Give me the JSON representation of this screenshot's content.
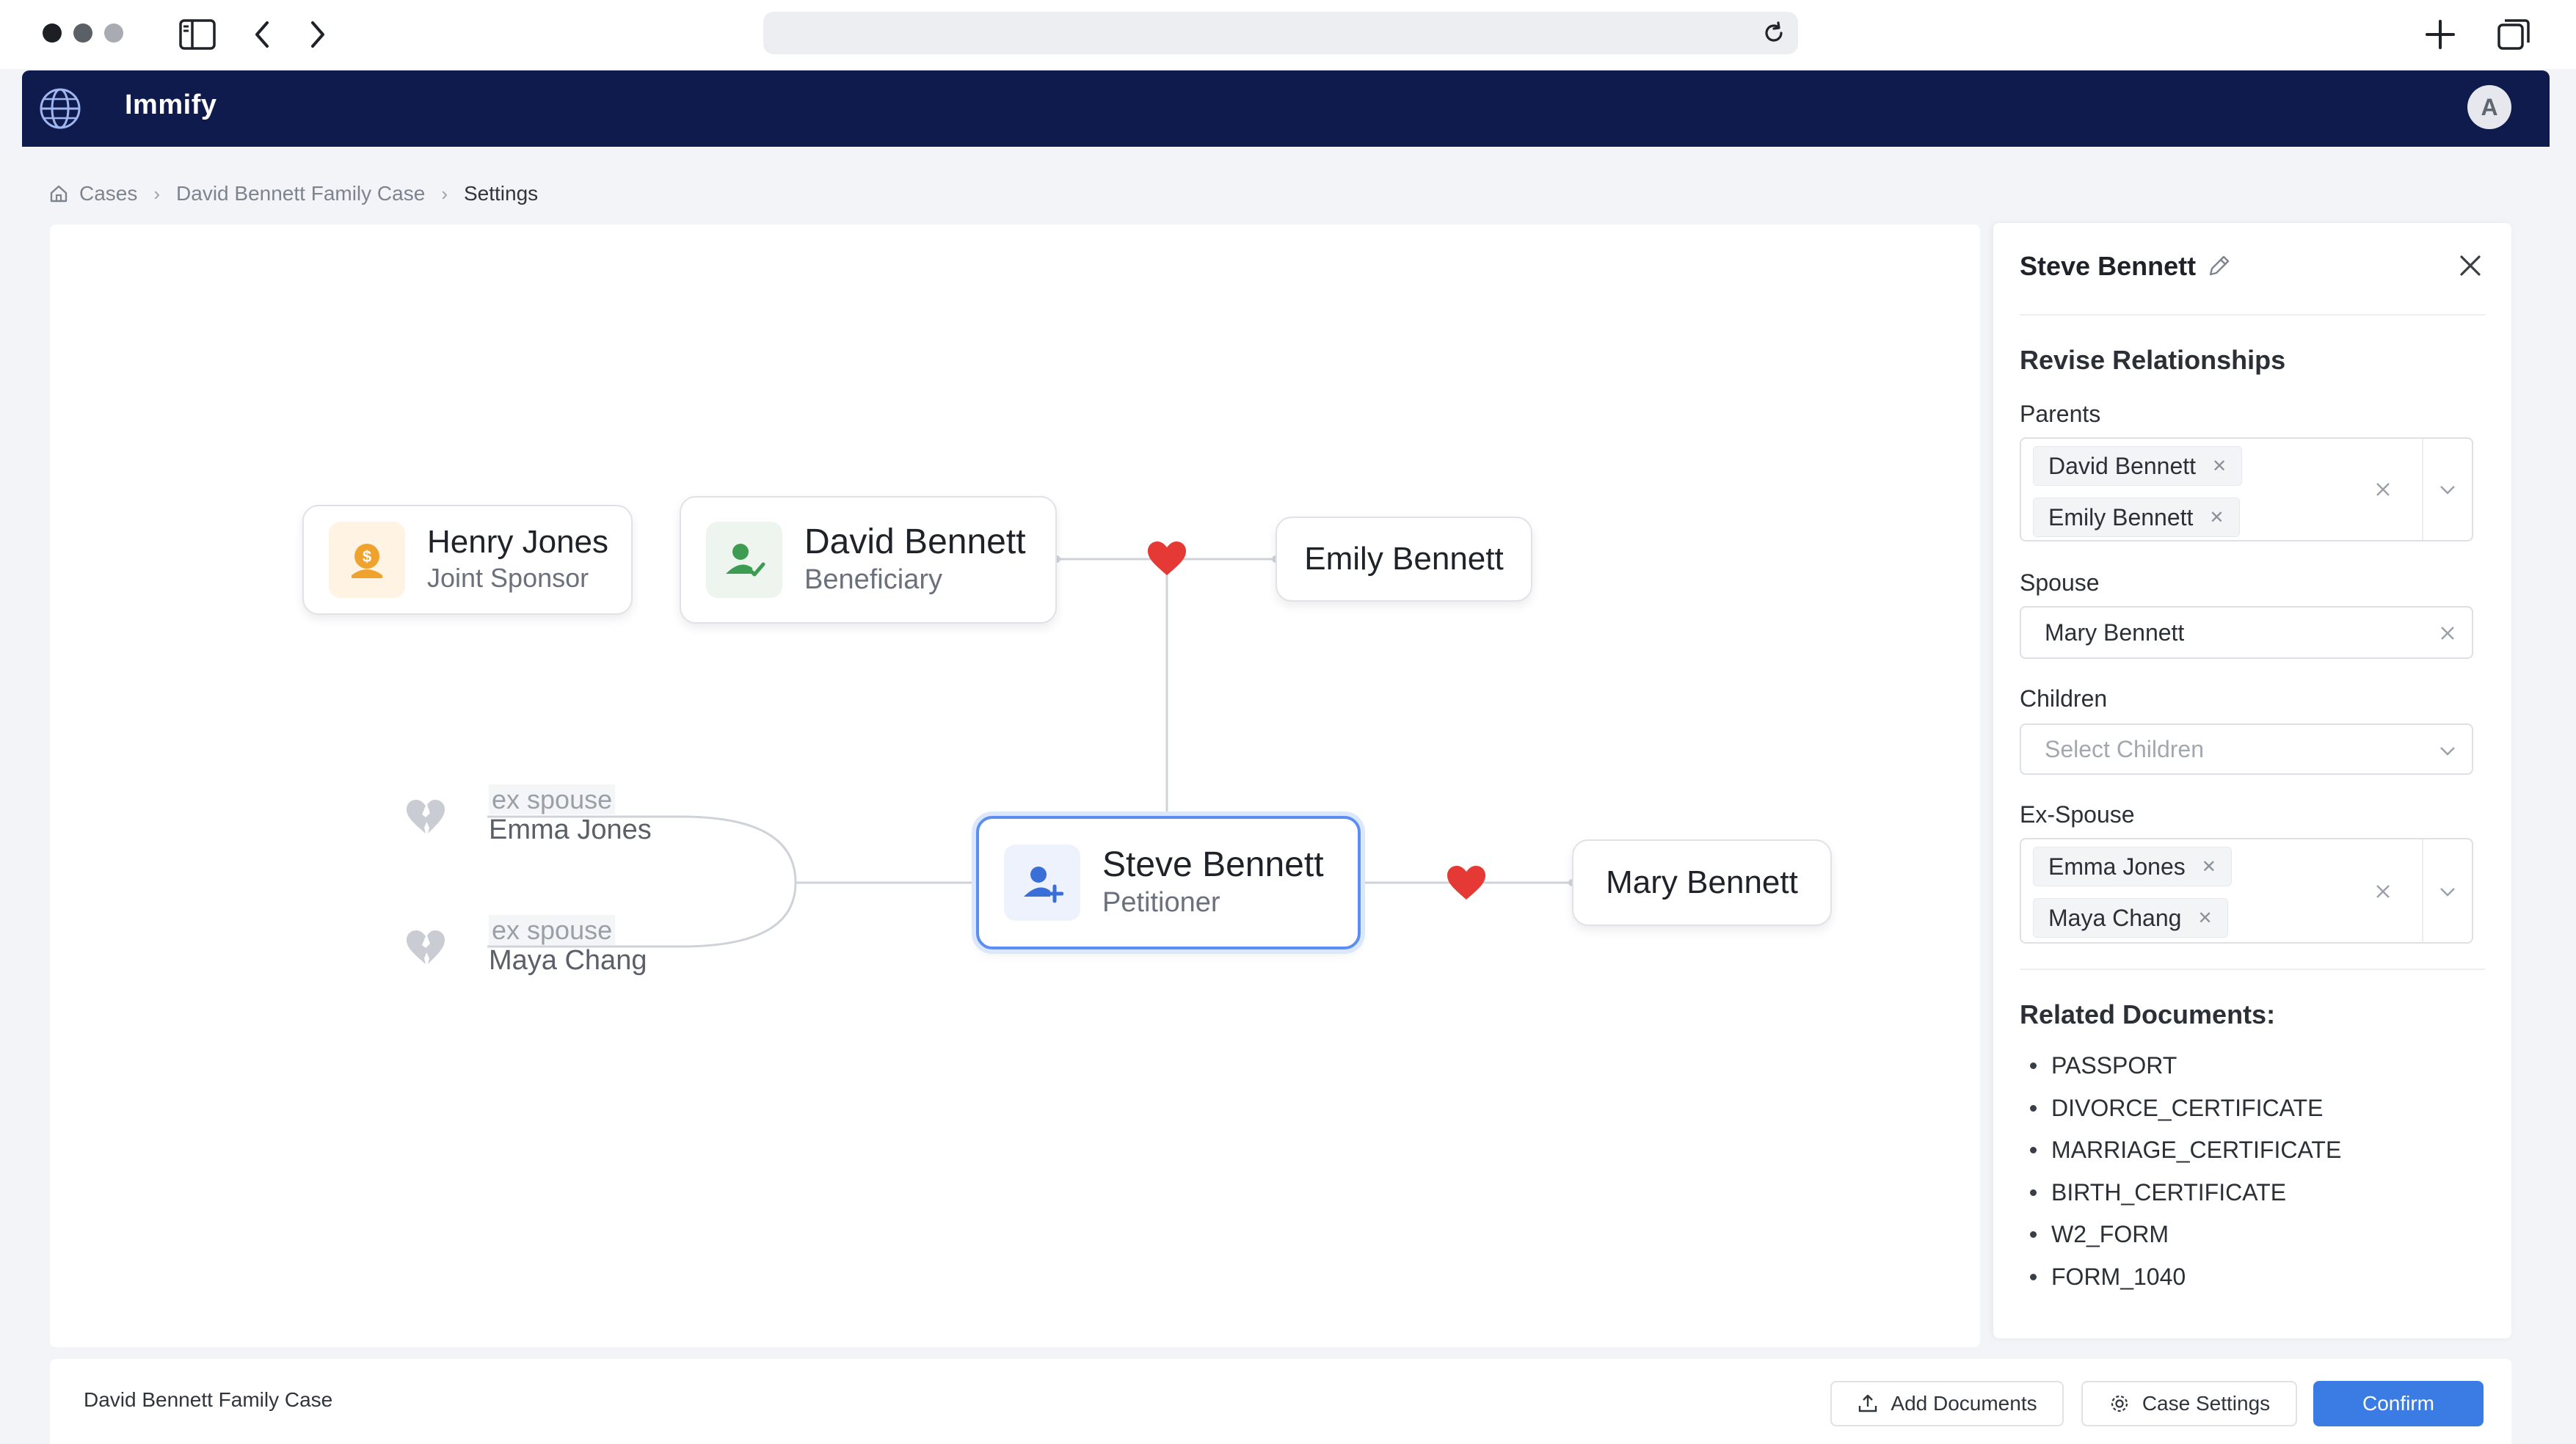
{
  "browser": {
    "url": ""
  },
  "app": {
    "brand": "Immify",
    "avatar_initial": "A",
    "colors": {
      "header_bg": "#0f1b4c",
      "accent": "#3b7be4",
      "heart": "#e53935"
    }
  },
  "breadcrumb": {
    "items": [
      "Cases",
      "David Bennett Family Case",
      "Settings"
    ]
  },
  "graph": {
    "nodes": {
      "henry": {
        "name": "Henry Jones",
        "role": "Joint Sponsor",
        "icon": "dollar-person-icon"
      },
      "david": {
        "name": "David Bennett",
        "role": "Beneficiary",
        "icon": "person-check-icon"
      },
      "emily": {
        "name": "Emily Bennett"
      },
      "steve": {
        "name": "Steve Bennett",
        "role": "Petitioner",
        "icon": "person-add-icon"
      },
      "mary": {
        "name": "Mary Bennett"
      }
    },
    "ex_spouses": [
      {
        "label": "ex spouse",
        "name": "Emma Jones"
      },
      {
        "label": "ex spouse",
        "name": "Maya Chang"
      }
    ]
  },
  "panel": {
    "title": "Steve Bennett",
    "section_title": "Revise Relationships",
    "parents": {
      "label": "Parents",
      "values": [
        "David Bennett",
        "Emily Bennett"
      ]
    },
    "spouse": {
      "label": "Spouse",
      "value": "Mary Bennett"
    },
    "children": {
      "label": "Children",
      "placeholder": "Select Children"
    },
    "ex_spouse": {
      "label": "Ex-Spouse",
      "values": [
        "Emma Jones",
        "Maya Chang"
      ]
    },
    "docs_title": "Related Documents:",
    "documents": [
      "PASSPORT",
      "DIVORCE_CERTIFICATE",
      "MARRIAGE_CERTIFICATE",
      "BIRTH_CERTIFICATE",
      "W2_FORM",
      "FORM_1040"
    ]
  },
  "footer": {
    "case_name": "David Bennett Family Case",
    "add_documents": "Add Documents",
    "case_settings": "Case Settings",
    "confirm": "Confirm"
  }
}
